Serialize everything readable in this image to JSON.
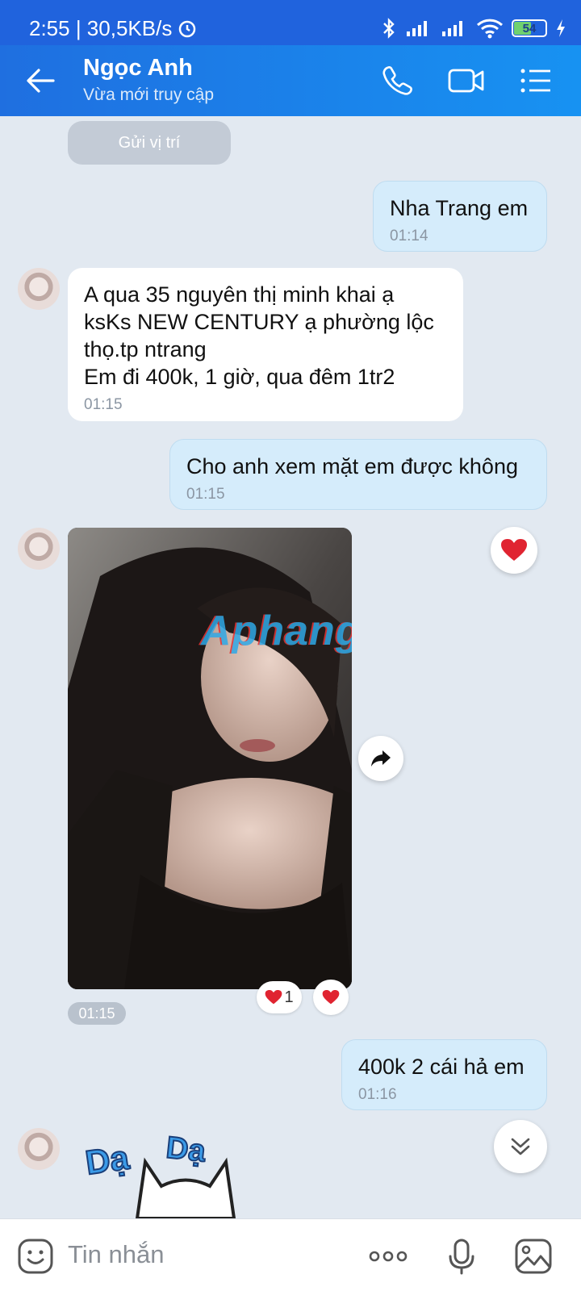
{
  "status_bar": {
    "time_speed": "2:55 | 30,5KB/s",
    "battery": "54"
  },
  "header": {
    "name": "Ngọc Anh",
    "status": "Vừa mới truy cập"
  },
  "messages": {
    "system_location": "Gửi vị trí",
    "m1": {
      "text": "Nha Trang em",
      "time": "01:14"
    },
    "m2": {
      "lines": [
        "A qua 35 nguyên thị minh khai ạ",
        "ksKs NEW CENTURY ạ  phường lộc",
        "thọ.tp ntrang",
        "Em đi 400k, 1 giờ,  qua đêm 1tr2"
      ],
      "time": "01:15"
    },
    "m3": {
      "text": "Cho anh xem mặt em được không",
      "time": "01:15"
    },
    "photo": {
      "time": "01:15",
      "reaction_count": "1",
      "watermark": "Aphang"
    },
    "m4": {
      "text": "400k 2 cái hả em",
      "time": "01:16"
    },
    "sticker": {
      "text1": "Dạ",
      "text2": "Dạ"
    }
  },
  "input": {
    "placeholder": "Tin nhắn"
  },
  "colors": {
    "header": "#1f6fe0",
    "outgoing_bubble": "#d5ecfb",
    "chat_bg": "#e2e9f1"
  }
}
